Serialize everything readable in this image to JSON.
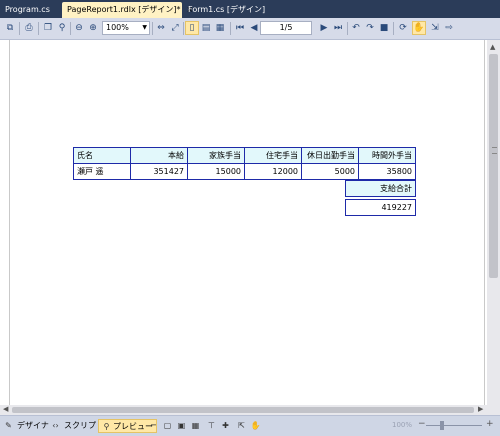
{
  "tabs": [
    {
      "label": "Program.cs",
      "active": false,
      "close": ""
    },
    {
      "label": "PageReport1.rdlx [デザイン]*",
      "active": true,
      "close": "×"
    },
    {
      "label": "Form1.cs [デザイン]",
      "active": false,
      "close": ""
    }
  ],
  "toolbar": {
    "zoom_value": "100%",
    "page_indicator": "1/5"
  },
  "report": {
    "headers": [
      "氏名",
      "本給",
      "家族手当",
      "住宅手当",
      "休日出勤手当",
      "時間外手当"
    ],
    "row": [
      "瀬戸 遥",
      "351427",
      "15000",
      "12000",
      "5000",
      "35800"
    ],
    "total_label": "支給合計",
    "total_value": "419227"
  },
  "statusbar": {
    "designer_label": "デザイナ",
    "script_label": "スクリプト",
    "preview_label": "プレビュー",
    "zoom_label": "100%"
  },
  "colors": {
    "header_bg": "#e2f8fb",
    "border": "#1e2aa8",
    "tab_active_bg": "#fff2c4",
    "frame_bg": "#2b3c59"
  }
}
